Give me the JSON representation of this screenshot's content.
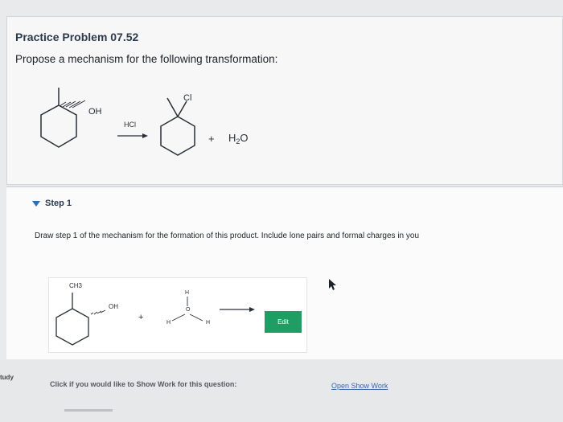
{
  "problem": {
    "title": "Practice Problem 07.52",
    "prompt": "Propose a mechanism for the following transformation:",
    "reaction": {
      "reactant_group": "OH",
      "reagent": "HCl",
      "product_halogen": "Cl",
      "plus": "+",
      "water_h": "H",
      "water_sub": "2",
      "water_o": "O"
    }
  },
  "step": {
    "label": "Step 1",
    "instructions": "Draw step 1 of the mechanism for the formation of this product. Include lone pairs and formal charges in you",
    "drawing": {
      "ch3": "CH3",
      "oh": "OH",
      "plus": "+",
      "h_top": "H",
      "o": "O",
      "h_left": "H",
      "h_right": "H"
    },
    "edit_label": "Edit"
  },
  "footer": {
    "side_label": "tudy",
    "show_work_prompt": "Click if you would like to Show Work for this question:",
    "show_work_link": "Open Show Work"
  }
}
